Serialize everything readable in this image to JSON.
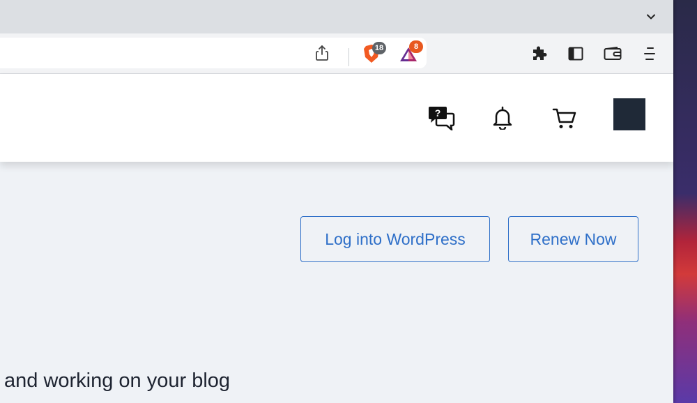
{
  "browser": {
    "extensions": {
      "brave_shields_count": "18",
      "brave_rewards_count": "8"
    }
  },
  "site_header": {
    "avatar_color": "#1f2937"
  },
  "actions": {
    "login_label": "Log into WordPress",
    "renew_label": "Renew Now"
  },
  "content": {
    "text": "and working on your blog"
  },
  "colors": {
    "accent": "#2e6fc8",
    "brave_orange": "#f25a22",
    "badge_gray": "#5f6368",
    "badge_orange": "#e8581f"
  },
  "icons": [
    "chevron-down-icon",
    "share-icon",
    "brave-shields-icon",
    "brave-rewards-icon",
    "puzzle-icon",
    "sidebar-icon",
    "wallet-icon",
    "menu-icon",
    "support-chat-icon",
    "bell-icon",
    "cart-icon"
  ]
}
